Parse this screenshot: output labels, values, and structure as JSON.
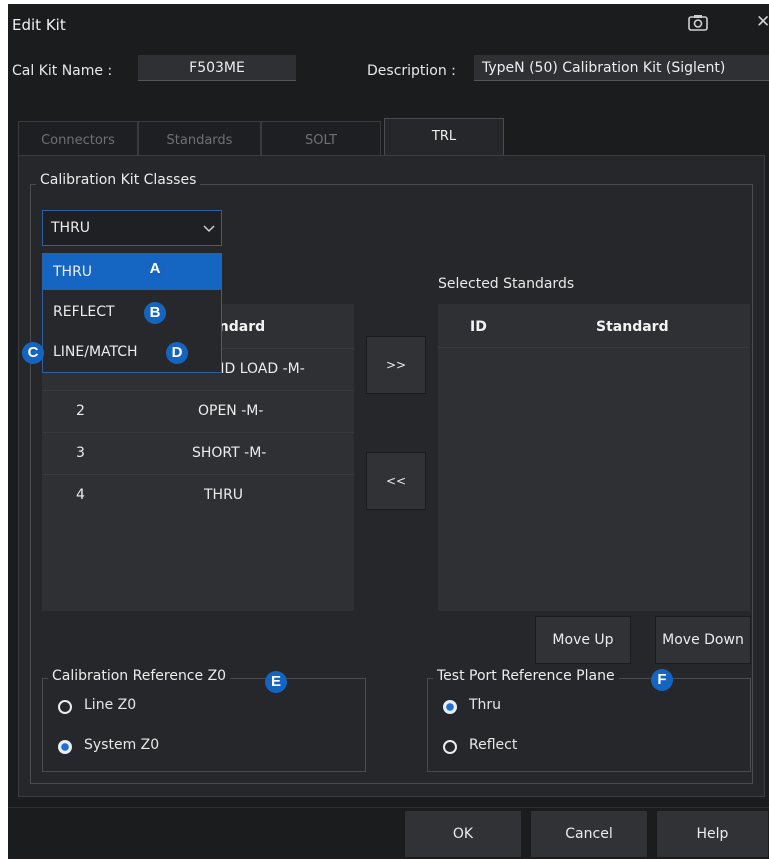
{
  "window": {
    "title": "Edit Kit"
  },
  "header": {
    "cal_kit_name_label": "Cal Kit Name :",
    "cal_kit_name_value": "F503ME",
    "description_label": "Description :",
    "description_value": "TypeN (50) Calibration Kit (Siglent)"
  },
  "tabs": [
    {
      "label": "Connectors"
    },
    {
      "label": "Standards"
    },
    {
      "label": "SOLT"
    },
    {
      "label": "TRL"
    }
  ],
  "classes": {
    "group_label": "Calibration Kit Classes",
    "selected": "THRU",
    "options": [
      "THRU",
      "REFLECT",
      "LINE/MATCH"
    ]
  },
  "available_table": {
    "header_standard_partial": "ındard",
    "rows": [
      {
        "id": "",
        "standard": "ND LOAD -M-"
      },
      {
        "id": "2",
        "standard": "OPEN -M-"
      },
      {
        "id": "3",
        "standard": "SHORT -M-"
      },
      {
        "id": "4",
        "standard": "THRU"
      }
    ]
  },
  "transfer": {
    "add": ">>",
    "remove": "<<"
  },
  "selected_standards": {
    "label": "Selected Standards",
    "col_id": "ID",
    "col_standard": "Standard"
  },
  "move": {
    "up": "Move Up",
    "down": "Move Down"
  },
  "ref_z0": {
    "label": "Calibration Reference Z0",
    "options": [
      "Line Z0",
      "System Z0"
    ],
    "selected": "System Z0"
  },
  "ref_plane": {
    "label": "Test Port Reference Plane",
    "options": [
      "Thru",
      "Reflect"
    ],
    "selected": "Thru"
  },
  "footer": {
    "ok": "OK",
    "cancel": "Cancel",
    "help": "Help"
  },
  "badges": {
    "a": "A",
    "b": "B",
    "c": "C",
    "d": "D",
    "e": "E",
    "f": "F"
  },
  "colors": {
    "accent": "#1566c3",
    "badge": "#1565c0",
    "background": "#1b1c1e",
    "panel": "#26272a"
  }
}
